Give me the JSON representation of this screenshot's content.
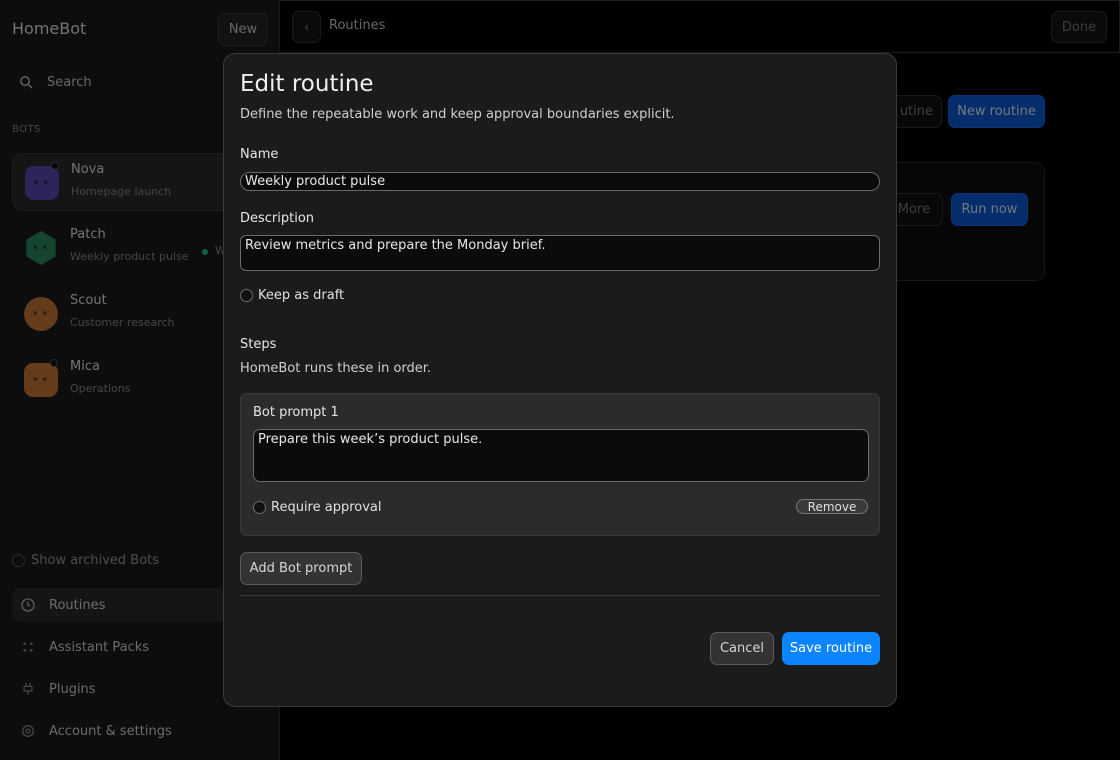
{
  "sidebar": {
    "brand": "HomeBot",
    "new_label": "New",
    "search_label": "Search",
    "section_label": "BOTS",
    "bots": [
      {
        "name": "Nova",
        "subtitle": "Homepage launch",
        "color": "#5b48b8"
      },
      {
        "name": "Patch",
        "subtitle": "Weekly product pulse",
        "color": "#2a8a5e",
        "status_letter": "W"
      },
      {
        "name": "Scout",
        "subtitle": "Customer research",
        "color": "#c87838"
      },
      {
        "name": "Mica",
        "subtitle": "Operations",
        "color": "#c87838"
      }
    ],
    "archived_label": "Show archived Bots",
    "nav": [
      {
        "label": "Routines"
      },
      {
        "label": "Assistant Packs"
      },
      {
        "label": "Plugins"
      },
      {
        "label": "Account & settings"
      }
    ]
  },
  "topbar": {
    "back": "‹",
    "crumb": "Routines",
    "done": "Done"
  },
  "background": {
    "routine_btn_partial": "utine",
    "new_routine": "New routine",
    "more": "More",
    "run_now": "Run now"
  },
  "modal": {
    "title": "Edit routine",
    "subtitle": "Define the repeatable work and keep approval boundaries explicit.",
    "name_label": "Name",
    "name_value": "Weekly product pulse",
    "description_label": "Description",
    "description_value": "Review metrics and prepare the Monday brief.",
    "draft_label": "Keep as draft",
    "steps_label": "Steps",
    "steps_sub": "HomeBot runs these in order.",
    "step": {
      "title": "Bot prompt 1",
      "prompt": "Prepare this week’s product pulse.",
      "approval_label": "Require approval",
      "remove_label": "Remove"
    },
    "add_label": "Add Bot prompt",
    "cancel_label": "Cancel",
    "save_label": "Save routine"
  },
  "colors": {
    "accent": "#0a84ff"
  }
}
